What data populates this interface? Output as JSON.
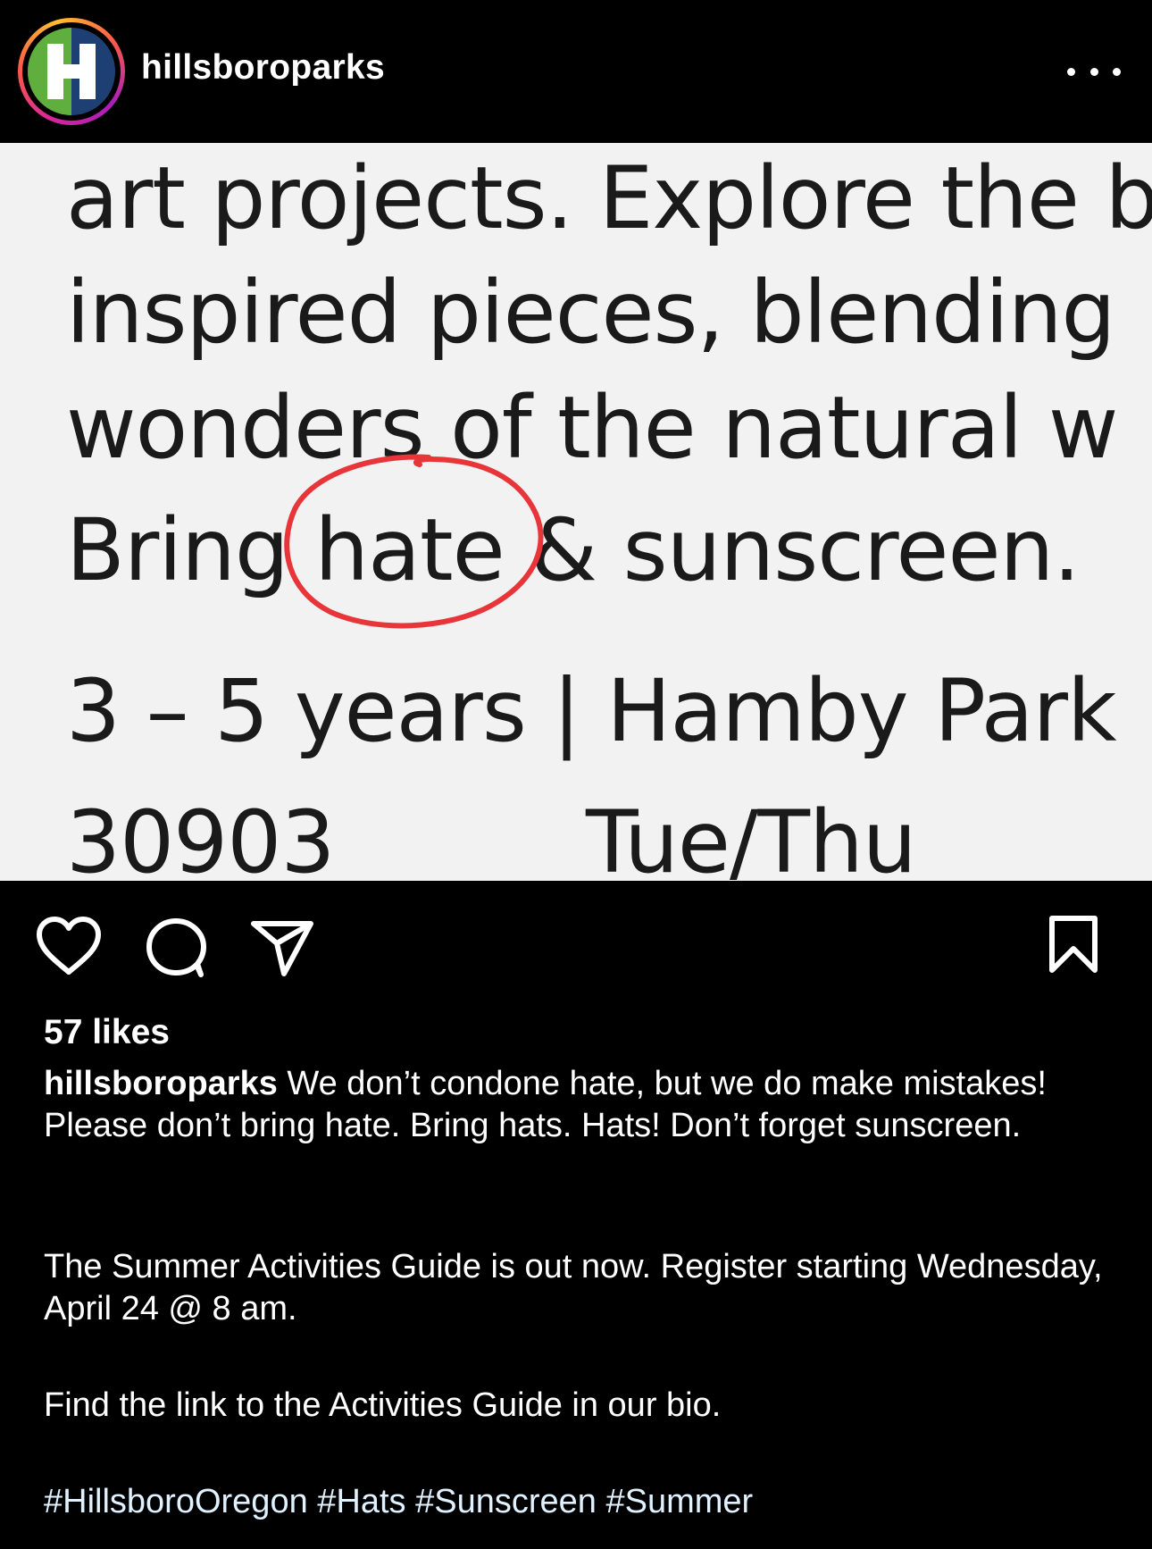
{
  "header": {
    "username": "hillsboroparks"
  },
  "post_image": {
    "lines": [
      "art projects. Explore the b",
      "inspired pieces, blending",
      "wonders of the natural w",
      "Bring hate & sunscreen.",
      "3 – 5 years | Hamby Park",
      "30903"
    ],
    "line6_right": "Tue/Thu"
  },
  "colors": {
    "circle_annotation": "#e8353a",
    "hashtag": "#e0f1ff"
  },
  "icons": [
    "heart-icon",
    "comment-icon",
    "send-icon",
    "bookmark-icon",
    "more-icon"
  ],
  "likes": "57 likes",
  "caption": {
    "username": "hillsboroparks",
    "text1": " We don’t condone hate, but we do make mistakes! Please don’t bring hate. Bring hats. Hats! Don’t forget sunscreen.",
    "text2": "The Summer Activities Guide is out now. Register starting Wednesday, April 24 @ 8 am.",
    "text3": "Find the link to the Activities Guide in our bio.",
    "hashtags": [
      "#HillsboroOregon",
      "#Hats",
      "#Sunscreen",
      "#Summer"
    ]
  }
}
